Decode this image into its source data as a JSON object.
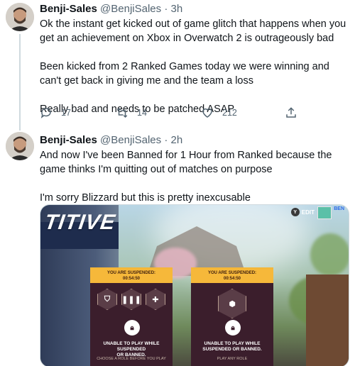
{
  "tweets": [
    {
      "author": "Benji-Sales",
      "handle": "@BenjiSales",
      "separator": "·",
      "time": "3h",
      "paragraphs": [
        "Ok the instant get kicked out of game glitch that happens when you get an achievement on Xbox in Overwatch 2 is outrageously bad",
        "Been kicked from 2 Ranked Games today we were winning and can't get back in giving me and the team a loss",
        "Really bad and needs to be patched ASAP"
      ],
      "replies": "17",
      "retweets": "14",
      "likes": "212"
    },
    {
      "author": "Benji-Sales",
      "handle": "@BenjiSales",
      "separator": "·",
      "time": "2h",
      "paragraphs": [
        "And now I've been Banned for 1 Hour from Ranked because the game thinks I'm quitting out of matches on purpose",
        "I'm sorry Blizzard but this is pretty inexcusable"
      ],
      "media": {
        "title": "TITIVE",
        "edit_label": "EDIT",
        "edit_key": "Y",
        "corner_label": "BEN",
        "cards": [
          {
            "suspended": "YOU ARE SUSPENDED:",
            "timer": "00:54:50",
            "roles": [
              "shield",
              "ammo",
              "plus"
            ],
            "unable_line1": "UNABLE TO PLAY WHILE SUSPENDED",
            "unable_line2": "OR BANNED.",
            "footer": "CHOOSE A ROLE BEFORE YOU PLAY"
          },
          {
            "suspended": "YOU ARE SUSPENDED:",
            "timer": "00:54:50",
            "roles": [
              "open-queue"
            ],
            "unable_line1": "UNABLE TO PLAY WHILE",
            "unable_line2": "SUSPENDED OR BANNED.",
            "footer": "PLAY ANY ROLE"
          }
        ]
      }
    }
  ],
  "colors": {
    "text_primary": "#0f1419",
    "text_secondary": "#536471",
    "divider": "#cfd9de",
    "suspend_banner": "#f6b83a"
  }
}
